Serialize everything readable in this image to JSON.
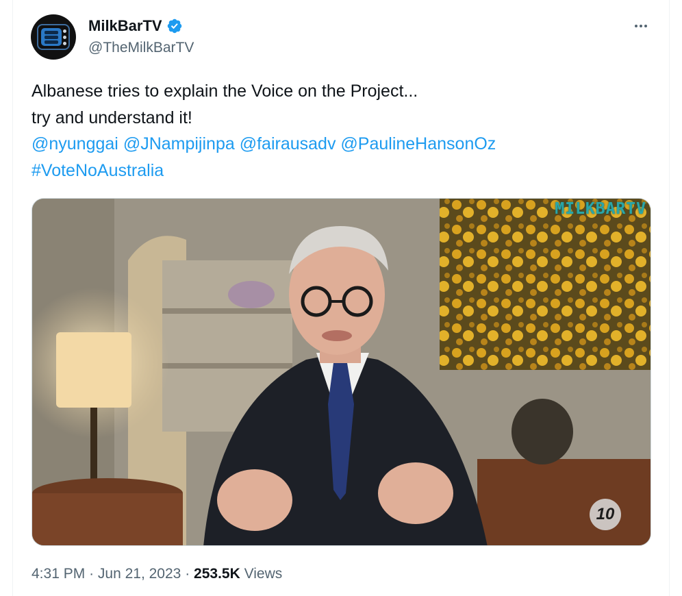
{
  "tweet": {
    "author": {
      "display_name": "MilkBarTV",
      "handle": "@TheMilkBarTV",
      "verified": true
    },
    "text_lines": [
      "Albanese tries to explain the Voice on the Project...",
      "try and understand it!"
    ],
    "mentions": [
      "@nyunggai",
      "@JNampijinpa",
      "@fairausadv",
      "@PaulineHansonOz"
    ],
    "hashtag": "#VoteNoAustralia",
    "media": {
      "watermark": "MILKBARTV",
      "channel_logo": "10"
    },
    "time": "4:31 PM",
    "date": "Jun 21, 2023",
    "views_count": "253.5K",
    "views_label": "Views",
    "separator": "·"
  },
  "icons": {
    "verified": "verified-badge-icon",
    "more": "more-options-icon"
  },
  "colors": {
    "link": "#1d9bf0",
    "secondary_text": "#536471",
    "primary_text": "#0f1419"
  }
}
